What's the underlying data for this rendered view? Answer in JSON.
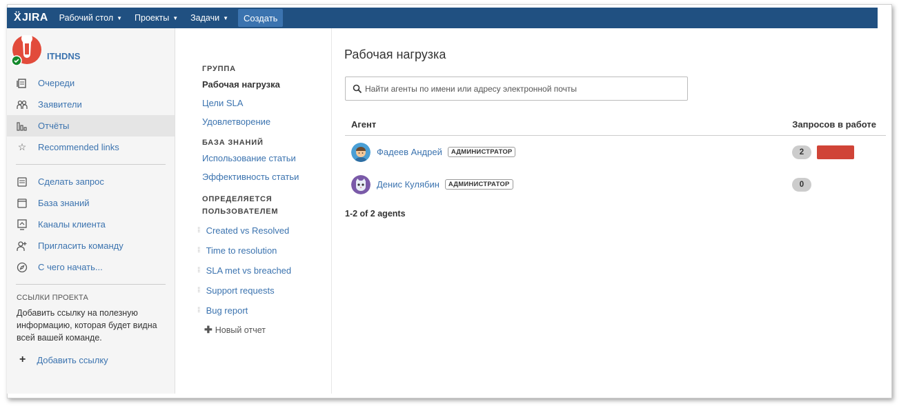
{
  "topnav": {
    "logo": "JIRA",
    "items": [
      {
        "label": "Рабочий стол"
      },
      {
        "label": "Проекты"
      },
      {
        "label": "Задачи"
      }
    ],
    "create_label": "Создать"
  },
  "sidebar": {
    "project_name": "ITHDNS",
    "items": [
      {
        "label": "Очереди",
        "icon": "queues-icon"
      },
      {
        "label": "Заявители",
        "icon": "customers-icon"
      },
      {
        "label": "Отчёты",
        "icon": "reports-icon",
        "active": true
      },
      {
        "label": "Recommended links",
        "icon": "star-icon"
      }
    ],
    "items2": [
      {
        "label": "Сделать запрос",
        "icon": "raise-request-icon"
      },
      {
        "label": "База знаний",
        "icon": "knowledge-base-icon"
      },
      {
        "label": "Каналы клиента",
        "icon": "channels-icon"
      },
      {
        "label": "Пригласить команду",
        "icon": "invite-team-icon"
      },
      {
        "label": "С чего начать...",
        "icon": "compass-icon"
      }
    ],
    "links_title": "ССЫЛКИ ПРОЕКТА",
    "links_desc": "Добавить ссылку на полезную информацию, которая будет видна всей вашей команде.",
    "add_link_label": "Добавить ссылку"
  },
  "reports": {
    "group_title": "ГРУППА",
    "group_items": [
      "Рабочая нагрузка",
      "Цели SLA",
      "Удовлетворение"
    ],
    "kb_title": "БАЗА ЗНАНИЙ",
    "kb_items": [
      "Использование статьи",
      "Эффективность статьи"
    ],
    "custom_title_1": "ОПРЕДЕЛЯЕТСЯ",
    "custom_title_2": "ПОЛЬЗОВАТЕЛЕМ",
    "custom_items": [
      "Created vs Resolved",
      "Time to resolution",
      "SLA met vs breached",
      "Support requests",
      "Bug report"
    ],
    "new_report_label": "Новый отчет"
  },
  "main": {
    "title": "Рабочая нагрузка",
    "search_placeholder": "Найти агенты по имени или адресу электронной почты",
    "col_agent": "Агент",
    "col_requests": "Запросов в работе",
    "agents": [
      {
        "name": "Фадеев Андрей",
        "role": "АДМИНИСТРАТОР",
        "count": "2",
        "load_color": "#d04437"
      },
      {
        "name": "Денис Кулябин",
        "role": "АДМИНИСТРАТОР",
        "count": "0"
      }
    ],
    "agents_count": "1-2 of 2 agents"
  },
  "colors": {
    "nav_bg": "#205081",
    "link": "#3b73af",
    "create_btn": "#3b73af",
    "load_bar": "#d04437"
  }
}
